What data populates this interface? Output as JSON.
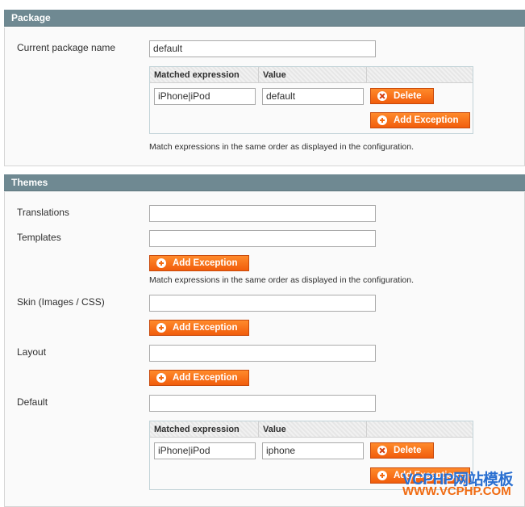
{
  "package": {
    "title": "Package",
    "current_package_label": "Current package name",
    "current_package_value": "default",
    "grid": {
      "col_expression": "Matched expression",
      "col_value": "Value",
      "rows": [
        {
          "expression": "iPhone|iPod",
          "value": "default",
          "delete_label": "Delete"
        }
      ],
      "add_exception_label": "Add Exception"
    },
    "note": "Match expressions in the same order as displayed in the configuration."
  },
  "themes": {
    "title": "Themes",
    "translations_label": "Translations",
    "translations_value": "",
    "templates_label": "Templates",
    "templates_value": "",
    "templates_add_label": "Add Exception",
    "templates_note": "Match expressions in the same order as displayed in the configuration.",
    "skin_label": "Skin (Images / CSS)",
    "skin_value": "",
    "skin_add_label": "Add Exception",
    "layout_label": "Layout",
    "layout_value": "",
    "layout_add_label": "Add Exception",
    "default_label": "Default",
    "default_value": "",
    "grid": {
      "col_expression": "Matched expression",
      "col_value": "Value",
      "rows": [
        {
          "expression": "iPhone|iPod",
          "value": "iphone",
          "delete_label": "Delete"
        }
      ],
      "add_exception_label": "Add Exception"
    }
  },
  "watermark": {
    "line1": "VCPHP网站模板",
    "line2": "WWW.VCPHP.COM"
  }
}
